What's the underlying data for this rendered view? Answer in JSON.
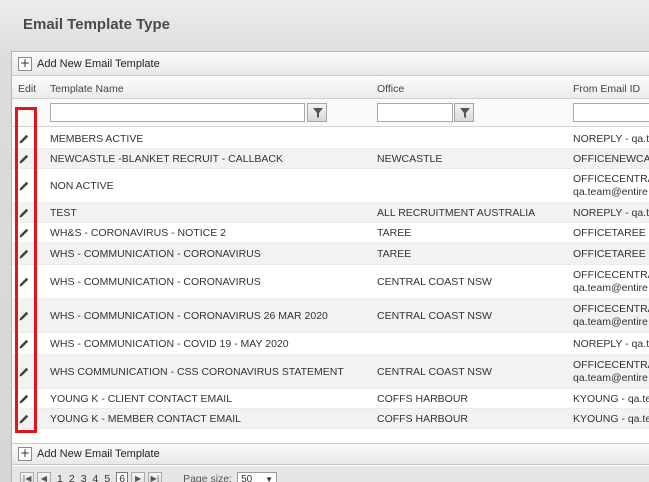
{
  "page": {
    "title": "Email Template Type"
  },
  "toolbar": {
    "add_label": "Add New Email Template",
    "plus_glyph": "+"
  },
  "columns": {
    "edit": "Edit",
    "template_name": "Template Name",
    "office": "Office",
    "from_email": "From Email ID"
  },
  "filters": {
    "template_name_value": "",
    "office_value": "",
    "from_email_value": ""
  },
  "rows": [
    {
      "name": "MEMBERS ACTIVE",
      "office": "",
      "from1": "NOREPLY - qa.te",
      "from2": ""
    },
    {
      "name": "NEWCASTLE -BLANKET RECRUIT - CALLBACK",
      "office": "NEWCASTLE",
      "from1": "OFFICENEWCAS",
      "from2": ""
    },
    {
      "name": "NON ACTIVE",
      "office": "",
      "from1": "OFFICECENTRAI",
      "from2": "qa.team@entire"
    },
    {
      "name": "TEST",
      "office": "ALL RECRUITMENT AUSTRALIA",
      "from1": "NOREPLY - qa.te",
      "from2": ""
    },
    {
      "name": "WH&S - CORONAVIRUS - NOTICE 2",
      "office": "TAREE",
      "from1": "OFFICETAREE - ",
      "from2": ""
    },
    {
      "name": "WHS - COMMUNICATION - CORONAVIRUS",
      "office": "TAREE",
      "from1": "OFFICETAREE - ",
      "from2": ""
    },
    {
      "name": "WHS - COMMUNICATION - CORONAVIRUS",
      "office": "CENTRAL COAST NSW",
      "from1": "OFFICECENTRAI",
      "from2": "qa.team@entire"
    },
    {
      "name": "WHS - COMMUNICATION - CORONAVIRUS 26 MAR 2020",
      "office": "CENTRAL COAST NSW",
      "from1": "OFFICECENTRAI",
      "from2": "qa.team@entire"
    },
    {
      "name": "WHS - COMMUNICATION - COVID 19 - MAY 2020",
      "office": "",
      "from1": "NOREPLY - qa.te",
      "from2": ""
    },
    {
      "name": "WHS COMMUNICATION - CSS CORONAVIRUS STATEMENT",
      "office": "CENTRAL COAST NSW",
      "from1": "OFFICECENTRAI",
      "from2": "qa.team@entire"
    },
    {
      "name": "YOUNG K - CLIENT CONTACT EMAIL",
      "office": "COFFS HARBOUR",
      "from1": "KYOUNG - qa.te",
      "from2": ""
    },
    {
      "name": "YOUNG K - MEMBER CONTACT EMAIL",
      "office": "COFFS HARBOUR",
      "from1": "KYOUNG - qa.te",
      "from2": ""
    }
  ],
  "pager": {
    "pages": [
      "1",
      "2",
      "3",
      "4",
      "5",
      "6"
    ],
    "current_page": "6",
    "page_size_label": "Page size:",
    "page_size_value": "50",
    "first_glyph": "|◀",
    "prev_glyph": "◀",
    "next_glyph": "▶",
    "last_glyph": "▶|"
  },
  "colors": {
    "highlight": "#e1141e",
    "alt_row": "#f2f2f2"
  },
  "icons": {
    "edit": "pencil-icon",
    "filter": "funnel-icon",
    "add": "plus-icon"
  }
}
